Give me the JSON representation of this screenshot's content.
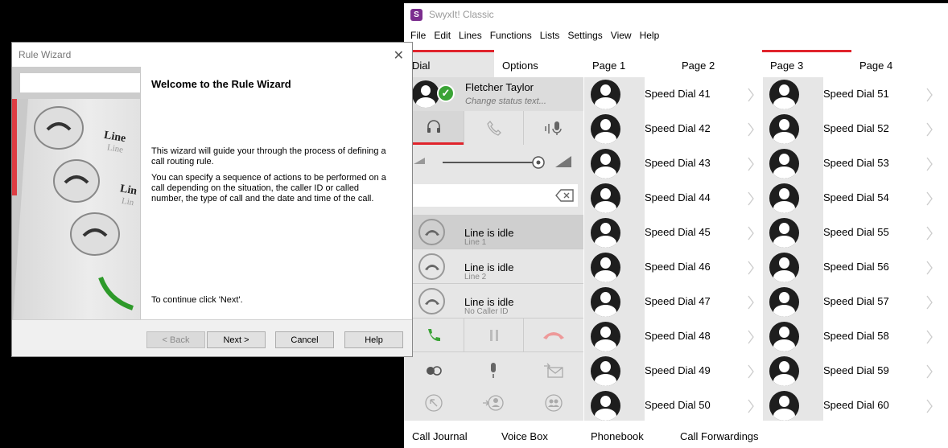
{
  "swyx": {
    "title": "SwyxIt! Classic",
    "menu": [
      "File",
      "Edit",
      "Lines",
      "Functions",
      "Lists",
      "Settings",
      "View",
      "Help"
    ],
    "tabs": [
      "Dial",
      "Options",
      "Page 1",
      "Page 2",
      "Page 3",
      "Page 4"
    ],
    "user": {
      "name": "Fletcher Taylor",
      "status_placeholder": "Change status text..."
    },
    "lines": [
      {
        "status": "Line is idle",
        "sub": "Line 1"
      },
      {
        "status": "Line is idle",
        "sub": "Line 2"
      },
      {
        "status": "Line is idle",
        "sub": "No Caller ID"
      }
    ],
    "speed_dials_col1": [
      "Speed Dial 41",
      "Speed Dial 42",
      "Speed Dial 43",
      "Speed Dial 44",
      "Speed Dial 45",
      "Speed Dial 46",
      "Speed Dial 47",
      "Speed Dial 48",
      "Speed Dial 49",
      "Speed Dial 50"
    ],
    "speed_dials_col2": [
      "Speed Dial 51",
      "Speed Dial 52",
      "Speed Dial 53",
      "Speed Dial 54",
      "Speed Dial 55",
      "Speed Dial 56",
      "Speed Dial 57",
      "Speed Dial 58",
      "Speed Dial 59",
      "Speed Dial 60"
    ],
    "bottom_tabs": [
      "Call Journal",
      "Voice Box",
      "Phonebook",
      "Call Forwardings"
    ],
    "accent": "#e0242c",
    "green": "#3aa335"
  },
  "wizard": {
    "title": "Rule Wizard",
    "heading": "Welcome to the Rule Wizard",
    "para1": "This wizard will guide your through the process of defining a call routing rule.",
    "para2": "You can specify a sequence of actions to be performed on a call depending on the situation, the caller ID or called number, the type of call and the date and time of the call.",
    "para3": "To continue click 'Next'.",
    "buttons": {
      "back": "< Back",
      "next": "Next >",
      "cancel": "Cancel",
      "help": "Help"
    },
    "image_lines": [
      "Line",
      "Line",
      "Lin",
      "Lin"
    ]
  }
}
